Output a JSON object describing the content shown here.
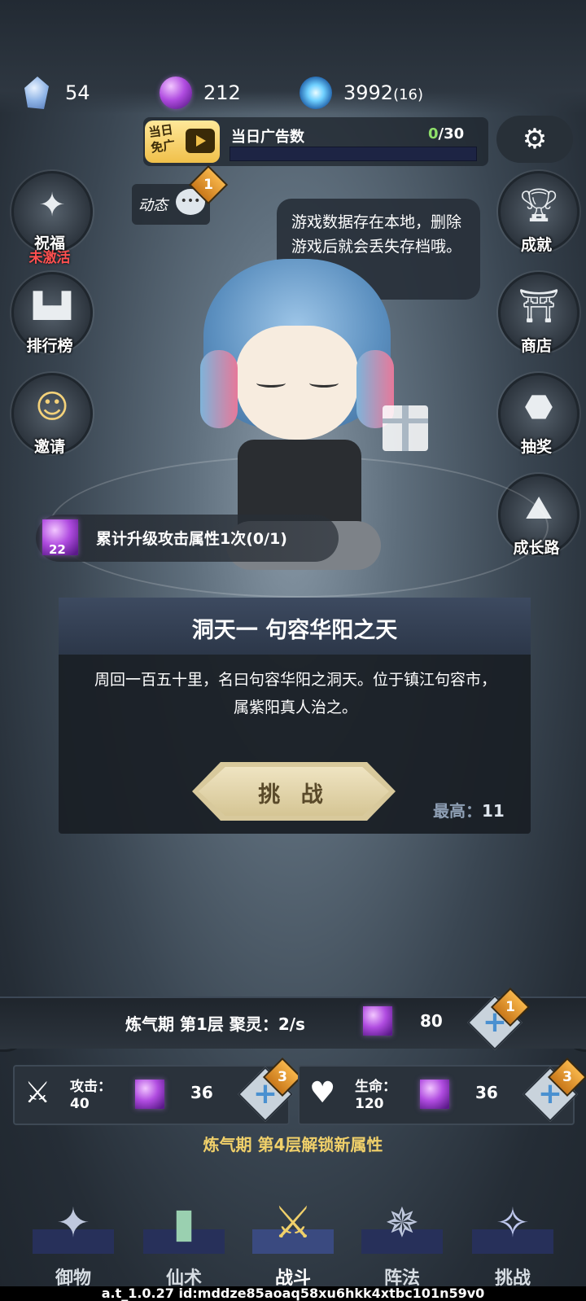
{
  "resources": {
    "crystal": {
      "icon": "crystal-icon",
      "value": "54"
    },
    "orb": {
      "icon": "purple-orb-icon",
      "value": "212"
    },
    "energy": {
      "icon": "lightning-orb-icon",
      "value": "3992",
      "extra": "(16)"
    }
  },
  "ad": {
    "badge_line1": "当日",
    "badge_line2": "免广",
    "title": "当日广告数",
    "current": "0",
    "total": "/30",
    "progress": 0
  },
  "settings_icon": "gear-icon",
  "left_menu": [
    {
      "label": "祝福",
      "sub": "未激活",
      "icon": "compass-star-icon"
    },
    {
      "label": "排行榜",
      "icon": "podium-icon"
    },
    {
      "label": "邀请",
      "icon": "invite-user-icon"
    }
  ],
  "right_menu": [
    {
      "label": "成就",
      "icon": "trophy-icon"
    },
    {
      "label": "商店",
      "icon": "shop-icon"
    },
    {
      "label": "抽奖",
      "icon": "lottery-icon"
    },
    {
      "label": "成长路",
      "icon": "mountain-icon"
    }
  ],
  "dynamic": {
    "label": "动态",
    "badge": "1"
  },
  "speech": "游戏数据存在本地，删除游戏后就会丢失存档哦。",
  "upgrade_task": {
    "level": "22",
    "text": "累计升级攻击属性1次(0/1)"
  },
  "stage": {
    "title": "洞天一 句容华阳之天",
    "desc": "周回一百五十里，名曰句容华阳之洞天。位于镇江句容市，属紫阳真人治之。",
    "button": "挑 战",
    "best_label": "最高：",
    "best_value": "11"
  },
  "cultivation": {
    "text": "炼气期 第1层 聚灵：2/s",
    "cost": "80",
    "badge": "1"
  },
  "stats": [
    {
      "label": "攻击：",
      "value": "40",
      "cost": "36",
      "badge": "3",
      "icon": "sword-icon"
    },
    {
      "label": "生命：",
      "value": "120",
      "cost": "36",
      "badge": "3",
      "icon": "heart-icon"
    }
  ],
  "unlock_text": "炼气期 第4层解锁新属性",
  "nav": [
    {
      "label": "御物",
      "icon": "flying-sword-icon"
    },
    {
      "label": "仙术",
      "icon": "spell-card-icon"
    },
    {
      "label": "战斗",
      "icon": "battle-trident-icon",
      "active": true
    },
    {
      "label": "阵法",
      "icon": "formation-icon"
    },
    {
      "label": "挑战",
      "icon": "challenge-icon"
    }
  ],
  "footer": "a.t_1.0.27 id:mddze85aoaq58xu6hkk4xtbc101n59v0",
  "colors": {
    "accent_gold": "#f0d06a",
    "inactive_red": "#ff5050",
    "progress_green": "#8fe06a"
  }
}
